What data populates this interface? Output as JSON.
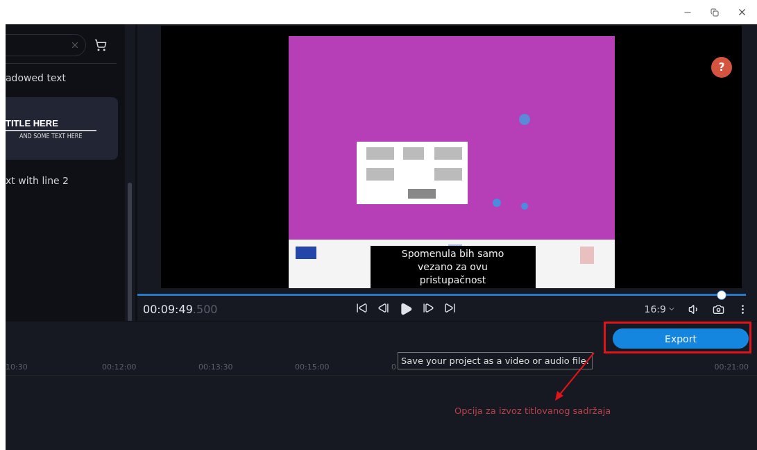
{
  "left_panel": {
    "items": [
      {
        "kind": "text",
        "label": "adowed text"
      },
      {
        "kind": "card",
        "title": "TITLE HERE",
        "subtitle": "AND SOME TEXT HERE"
      },
      {
        "kind": "text",
        "label": "xt with line 2"
      }
    ]
  },
  "player": {
    "help": "?",
    "subtitle_lines": [
      "Spomenula bih samo",
      "vezano za ovu",
      "pristupačnost"
    ],
    "progress": {
      "level": 0.96
    },
    "timecode": "00:09:49",
    "timecode_fraction": ".500",
    "aspect": "16:9"
  },
  "timeline": {
    "export_button": "Export",
    "ruler": [
      "10:30",
      "00:12:00",
      "00:13:30",
      "00:15:00",
      "0",
      "00:21:00"
    ],
    "tooltip": "Save your project as a video or audio file."
  },
  "annotation": {
    "text": "Opcija za izvoz titlovanog sadržaja"
  }
}
